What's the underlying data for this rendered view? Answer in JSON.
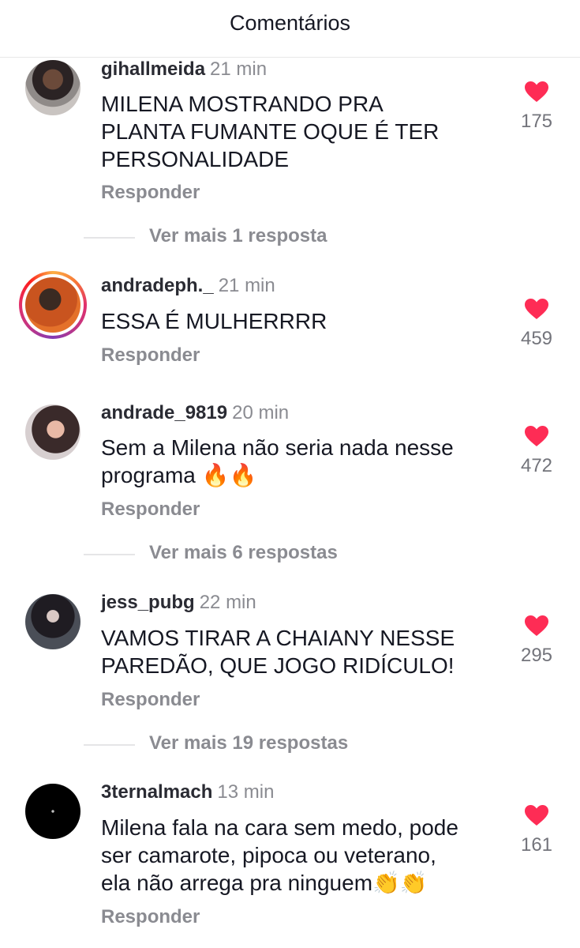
{
  "header": {
    "title": "Comentários"
  },
  "comments": [
    {
      "username": "gihallmeida",
      "time": "21 min",
      "text": "MILENA MOSTRANDO PRA\nPLANTA FUMANTE OQUE É TER\nPERSONALIDADE",
      "reply": "Responder",
      "likes": "175",
      "more": "Ver mais 1 resposta"
    },
    {
      "username": "andradeph._",
      "time": "21 min",
      "text": "ESSA É MULHERRRR",
      "reply": "Responder",
      "likes": "459"
    },
    {
      "username": "andrade_9819",
      "time": "20 min",
      "text": "Sem a Milena não seria nada nesse\nprograma 🔥🔥",
      "reply": "Responder",
      "likes": "472",
      "more": "Ver mais 6 respostas"
    },
    {
      "username": "jess_pubg",
      "time": "22 min",
      "text": "VAMOS TIRAR A CHAIANY NESSE\nPAREDÃO, QUE JOGO RIDÍCULO!",
      "reply": "Responder",
      "likes": "295",
      "more": "Ver mais 19 respostas"
    },
    {
      "username": "3ternalmach",
      "time": "13 min",
      "text": "Milena fala na cara sem medo, pode\nser camarote, pipoca ou veterano,\nela não arrega pra ninguem👏👏",
      "reply": "Responder",
      "likes": "161"
    }
  ],
  "colors": {
    "heart": "#fe2c55",
    "muted_text": "#8a8b91",
    "main_text": "#161823"
  },
  "icons": {
    "heart": "heart-icon"
  }
}
